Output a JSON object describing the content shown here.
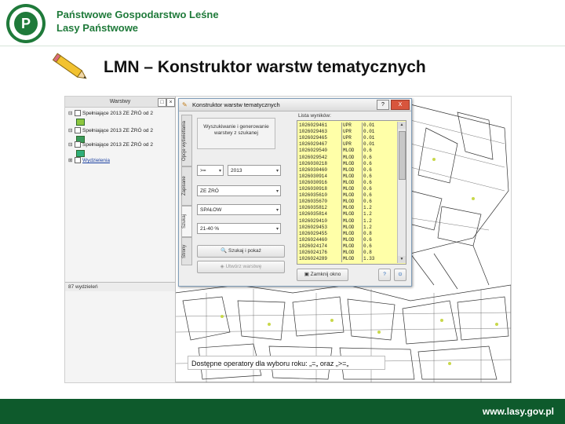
{
  "header": {
    "org_line1": "Państwowe Gospodarstwo Leśne",
    "org_line2": "Lasy Państwowe",
    "brand_color": "#1f7a3a"
  },
  "slide": {
    "title": "LMN – Konstruktor warstw tematycznych",
    "icon": "pencil-icon"
  },
  "layers_panel": {
    "title": "Warstwy",
    "items": [
      {
        "label": "Spełniające 2013 ZE ŻRÓ od 2",
        "swatch_color": "#8dc63f"
      },
      {
        "label": "Spełniające 2013 ZE ŻRÓ od 2",
        "swatch_color": "#3a9a5c"
      },
      {
        "label": "Spełniające 2013 ZE ŻRÓ od 2",
        "swatch_color": "#2fae7a"
      },
      {
        "label": "Wydzielenia",
        "swatch_color": ""
      }
    ],
    "status": "87 wydzieleń"
  },
  "dialog": {
    "title": "Konstruktor warstw tematycznych",
    "help_btn": "?",
    "close_btn": "X",
    "tabs": [
      "Opcje wyświetlania",
      "Zapisane",
      "Szukaj",
      "Strony"
    ],
    "generate_btn": "Wyszukiwanie i generowanie warstwy z szukanej",
    "operator_value": ">=",
    "year_value": "2013",
    "field2_value": "ZE ŻRÓ",
    "field3_value": "SPAŁOW",
    "field4_value": "21-40 %",
    "search_btn": "Szukaj i pokaż",
    "save_btn": "Utwórz warstwę",
    "list_label": "Lista wyników:",
    "list_rows": [
      {
        "id": "1026029461",
        "code": "UPR",
        "val": "0.01"
      },
      {
        "id": "1026029463",
        "code": "UPR",
        "val": "0.01"
      },
      {
        "id": "1026029465",
        "code": "UPR",
        "val": "0.01"
      },
      {
        "id": "1026029467",
        "code": "UPR",
        "val": "0.01"
      },
      {
        "id": "1026029540",
        "code": "MLOD",
        "val": "0.6"
      },
      {
        "id": "1026029542",
        "code": "MLOD",
        "val": "0.6"
      },
      {
        "id": "1026030218",
        "code": "MLOD",
        "val": "0.6"
      },
      {
        "id": "1026030460",
        "code": "MLOD",
        "val": "0.6"
      },
      {
        "id": "1026030914",
        "code": "MLOD",
        "val": "0.6"
      },
      {
        "id": "1026030916",
        "code": "MLOD",
        "val": "0.6"
      },
      {
        "id": "1026030918",
        "code": "MLOD",
        "val": "0.6"
      },
      {
        "id": "1026035610",
        "code": "MLOD",
        "val": "0.6"
      },
      {
        "id": "1026035670",
        "code": "MLOD",
        "val": "0.6"
      },
      {
        "id": "1026035812",
        "code": "MLOD",
        "val": "1.2"
      },
      {
        "id": "1026035814",
        "code": "MLOD",
        "val": "1.2"
      },
      {
        "id": "1026029410",
        "code": "MLOD",
        "val": "1.2"
      },
      {
        "id": "1026029453",
        "code": "MLOD",
        "val": "1.2"
      },
      {
        "id": "1026029455",
        "code": "MLOD",
        "val": "0.8"
      },
      {
        "id": "1026024460",
        "code": "MLOD",
        "val": "0.6"
      },
      {
        "id": "1026024174",
        "code": "MLOD",
        "val": "0.6"
      },
      {
        "id": "1026024176",
        "code": "MLOD",
        "val": "0.8"
      },
      {
        "id": "1026024289",
        "code": "MLOD",
        "val": "1.33"
      }
    ],
    "clear_btn": "Zamknij okno"
  },
  "operators_note": "Dostępne operatory dla wyboru roku: „=„ oraz „>=„",
  "footer": {
    "url": "www.lasy.gov.pl",
    "color": "#0e5a2c"
  }
}
